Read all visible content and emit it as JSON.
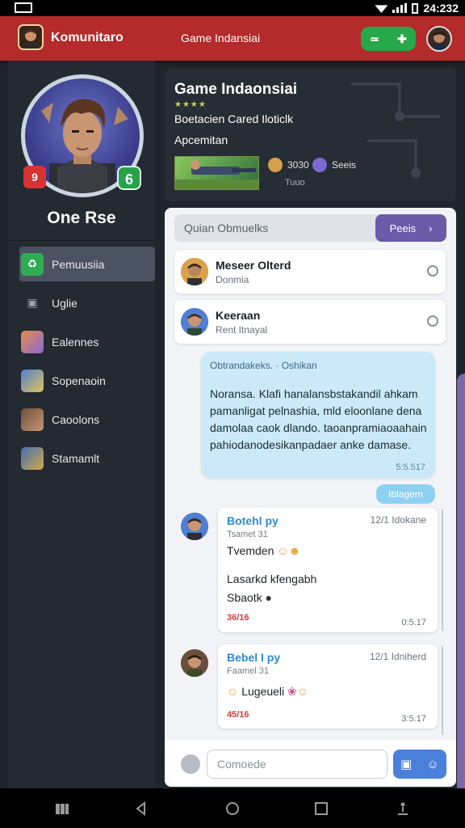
{
  "status": {
    "time": "24:232"
  },
  "appbar": {
    "app_name": "Komunitaro",
    "group_name": "Game Indansiai",
    "pill_left": "≃",
    "pill_right": "✚"
  },
  "sidebar": {
    "username": "One Rse",
    "badge_count": "9",
    "badge_level": "6",
    "items": [
      {
        "label": "Pemuusiia",
        "icon": "recycle-icon",
        "color": "#2eac52",
        "glyph": "♻"
      },
      {
        "label": "Uglie",
        "icon": "controller-icon",
        "color": "transparent",
        "glyph": "▣"
      },
      {
        "label": "Ealennes",
        "icon": "game-thumb-icon",
        "color": "#8a6ad6",
        "glyph": ""
      },
      {
        "label": "Sopenaoin",
        "icon": "hero-thumb-icon",
        "color": "#4f7fd3",
        "glyph": ""
      },
      {
        "label": "Caoolons",
        "icon": "character-thumb-icon",
        "color": "#6a4f3c",
        "glyph": ""
      },
      {
        "label": "Stamamlt",
        "icon": "weapon-thumb-icon",
        "color": "#3f6fb0",
        "glyph": ""
      }
    ]
  },
  "group": {
    "title": "Game Indaonsiai",
    "stars": "★★★★",
    "subtitle": "Boetacien Cared Iloticlk",
    "tagline": "Apcemitan",
    "stat1": "3030",
    "stat2": "Seeis",
    "stat_sub": "Tuuo",
    "color_stat1": "#d3a24a",
    "color_stat2": "#7a6ad0"
  },
  "chat": {
    "search_placeholder": "Quian Obmuelks",
    "search_button": "Peeis",
    "members": [
      {
        "name": "Meseer Olterd",
        "status": "Donmia"
      },
      {
        "name": "Keeraan",
        "status": "Rent Itnayal"
      }
    ],
    "message": {
      "header": "Obtrandakeks. · Oshikan",
      "body": "Noransa. Klafi hanalansbstakandil ahkam pamanligat pelnashia, mld eloonlane dena damolaa caok dlando. taoanpramiaoaahain pahiodanodesikanpadaer anke damase.",
      "time": "5:5.517"
    },
    "reply_chip": "Iblagem",
    "posts": [
      {
        "author": "Botehl py",
        "date": "12/1 Idokane",
        "role": "Tsamet 31",
        "line1": "Tvemden",
        "line2": "Lasarkd kfengabh",
        "line3": "Sbaotk",
        "react": "36/16",
        "time": "0:5.17"
      },
      {
        "author": "Bebel I py",
        "date": "12/1 Idniherd",
        "role": "Faamel 31",
        "line1": "Lugeueli",
        "react": "45/16",
        "time": "3:5.17"
      }
    ],
    "composer_placeholder": "Comoede"
  }
}
